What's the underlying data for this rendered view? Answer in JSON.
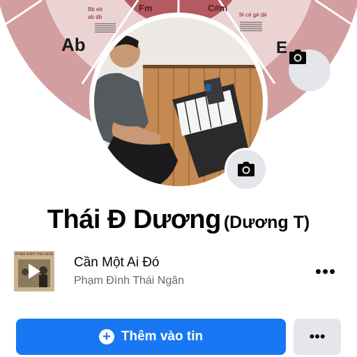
{
  "cover": {
    "wheel_keys": [
      "Fm",
      "C#m",
      "Ab",
      "E"
    ],
    "wheel_notes_left": [
      "Bb eb",
      "ab db"
    ],
    "wheel_notes_right": [
      "f# c# g# d#"
    ],
    "camera_icon": "camera-icon"
  },
  "avatar": {
    "camera_icon": "camera-icon"
  },
  "profile": {
    "name": "Thái Đ Dương",
    "alternate_name": "(Dương T)"
  },
  "music": {
    "album_label": "PHẠM ĐÌNH THÁI NGÂN",
    "play_icon": "play-icon",
    "song_title": "Cần Một Ai Đó",
    "artist": "Phạm Đình Thái Ngân",
    "more_label": "•••"
  },
  "actions": {
    "add_story_label": "Thêm vào tin",
    "add_story_icon": "plus-circle-icon",
    "more_label": "•••"
  },
  "colors": {
    "primary": "#1877f2",
    "secondary_button": "#e4e6eb",
    "wheel_outer": "#d39ea0",
    "wheel_inner": "#ecd3d3",
    "wheel_center": "#b45a60"
  }
}
